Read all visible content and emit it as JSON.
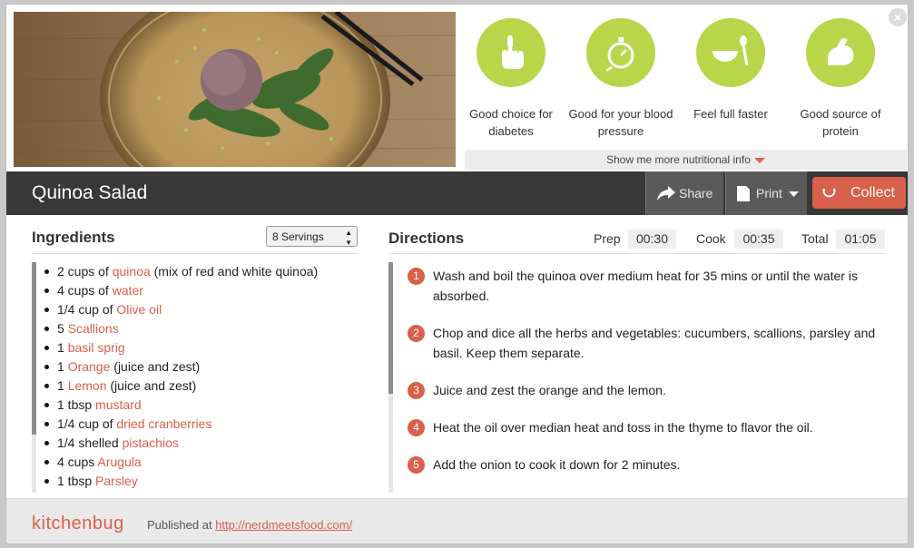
{
  "recipe": {
    "title": "Quinoa Salad",
    "photo_alt": "Quinoa salad ball on a plate with arugula and chopsticks"
  },
  "nutrition": {
    "badges": [
      {
        "label": "Good choice for diabetes",
        "icon": "hand-icon"
      },
      {
        "label": "Good for your blood pressure",
        "icon": "stopwatch-icon"
      },
      {
        "label": "Feel full faster",
        "icon": "bowl-spoon-icon"
      },
      {
        "label": "Good source of protein",
        "icon": "flexed-arm-icon"
      }
    ],
    "more_info_label": "Show me more nutritional info"
  },
  "toolbar": {
    "share_label": "Share",
    "print_label": "Print",
    "collect_label": "Collect"
  },
  "ingredients": {
    "heading": "Ingredients",
    "servings_selected": "8 Servings",
    "items": [
      {
        "pre": "2 cups of ",
        "link": "quinoa",
        "post": " (mix of red and white quinoa)"
      },
      {
        "pre": "4 cups of ",
        "link": "water",
        "post": ""
      },
      {
        "pre": "1/4 cup of ",
        "link": "Olive oil",
        "post": ""
      },
      {
        "pre": "5 ",
        "link": "Scallions",
        "post": ""
      },
      {
        "pre": "1 ",
        "link": "basil sprig",
        "post": ""
      },
      {
        "pre": "1 ",
        "link": "Orange",
        "post": " (juice and zest)"
      },
      {
        "pre": "1 ",
        "link": "Lemon",
        "post": " (juice and zest)"
      },
      {
        "pre": "1 tbsp ",
        "link": "mustard",
        "post": ""
      },
      {
        "pre": "1/4 cup of ",
        "link": "dried cranberries",
        "post": ""
      },
      {
        "pre": "1/4 shelled ",
        "link": "pistachios",
        "post": ""
      },
      {
        "pre": "4 cups ",
        "link": "Arugula",
        "post": ""
      },
      {
        "pre": "1 tbsp ",
        "link": "Parsley",
        "post": ""
      }
    ]
  },
  "directions": {
    "heading": "Directions",
    "prep_label": "Prep",
    "prep_value": "00:30",
    "cook_label": "Cook",
    "cook_value": "00:35",
    "total_label": "Total",
    "total_value": "01:05",
    "steps": [
      {
        "num": "1",
        "text": "Wash and boil the quinoa over medium heat for 35 mins or until the water is absorbed."
      },
      {
        "num": "2",
        "text": "Chop and dice all the herbs and vegetables: cucumbers, scallions, parsley and basil. Keep them separate."
      },
      {
        "num": "3",
        "text": "Juice and zest the orange and the lemon."
      },
      {
        "num": "4",
        "text": "Heat the oil over median heat and toss in the thyme to flavor the oil."
      },
      {
        "num": "5",
        "text": "Add the onion to cook it down for 2 minutes."
      }
    ]
  },
  "footer": {
    "logo_text": "kitchenbug",
    "published_label": "Published at",
    "published_url": "http://nerdmeetsfood.com/"
  },
  "colors": {
    "accent": "#d9604a",
    "badge_green": "#b9d54a",
    "title_bar": "#383838"
  }
}
